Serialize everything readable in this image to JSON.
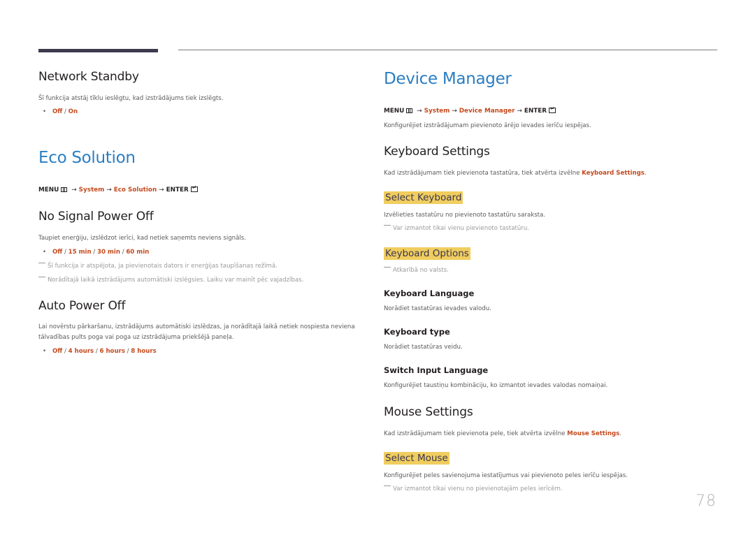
{
  "left": {
    "network_standby": {
      "title": "Network Standby",
      "description": "Šī funkcija atstāj tīklu ieslēgtu, kad izstrādājums tiek izslēgts.",
      "options": [
        "Off",
        "On"
      ]
    },
    "eco_solution": {
      "title": "Eco Solution",
      "menu_path": {
        "menu": "MENU",
        "arrow": "→",
        "system": "System",
        "item": "Eco Solution",
        "enter": "ENTER"
      }
    },
    "no_signal_power_off": {
      "title": "No Signal Power Off",
      "description": "Taupiet enerģiju, izslēdzot ierīci, kad netiek saņemts neviens signāls.",
      "options": [
        "Off",
        "15 min",
        "30 min",
        "60 min"
      ],
      "notes": [
        "Šī funkcija ir atspējota, ja pievienotais dators ir enerģijas taupīšanas režīmā.",
        "Norādītajā laikā izstrādājums automātiski izslēgsies. Laiku var mainīt pēc vajadzības."
      ]
    },
    "auto_power_off": {
      "title": "Auto Power Off",
      "description_line1": "Lai novērstu pārkaršanu, izstrādājums automātiski izslēdzas, ja norādītajā laikā netiek nospiesta neviena",
      "description_line2": "tālvadības pults poga vai poga uz izstrādājuma priekšējā paneļa.",
      "options": [
        "Off",
        "4 hours",
        "6 hours",
        "8 hours"
      ]
    }
  },
  "right": {
    "device_manager": {
      "title": "Device Manager",
      "menu_path": {
        "menu": "MENU",
        "arrow": "→",
        "system": "System",
        "item": "Device Manager",
        "enter": "ENTER"
      },
      "description": "Konfigurējiet izstrādājumam pievienoto ārējo ievades ierīču iespējas."
    },
    "keyboard_settings": {
      "title": "Keyboard Settings",
      "description_prefix": "Kad izstrādājumam tiek pievienota tastatūra, tiek atvērta izvēlne ",
      "description_link": "Keyboard Settings",
      "description_suffix": ".",
      "select_keyboard": {
        "title": "Select Keyboard",
        "description": "Izvēlieties tastatūru no pievienoto tastatūru saraksta.",
        "note": "Var izmantot tikai vienu pievienoto tastatūru."
      },
      "keyboard_options": {
        "title": "Keyboard Options",
        "note": "Atkarībā no valsts.",
        "items": [
          {
            "title": "Keyboard Language",
            "description": "Norādiet tastatūras ievades valodu."
          },
          {
            "title": "Keyboard type",
            "description": "Norādiet tastatūras veidu."
          },
          {
            "title": "Switch Input Language",
            "description": "Konfigurējiet taustiņu kombināciju, ko izmantot ievades valodas nomaiņai."
          }
        ]
      }
    },
    "mouse_settings": {
      "title": "Mouse Settings",
      "description_prefix": "Kad izstrādājumam tiek pievienota pele, tiek atvērta izvēlne ",
      "description_link": "Mouse Settings",
      "description_suffix": ".",
      "select_mouse": {
        "title": "Select Mouse",
        "description": "Konfigurējiet peles savienojuma iestatījumus vai pievienoto peles ierīču iespējas.",
        "note": "Var izmantot tikai vienu no pievienotajām peles ierīcēm."
      }
    }
  },
  "page_number": "78",
  "colors": {
    "heading_blue": "#2a7ec3",
    "option_orange": "#c44a1e",
    "highlight_yellow": "#f0cd5e",
    "top_bar": "#3d3a4e"
  }
}
